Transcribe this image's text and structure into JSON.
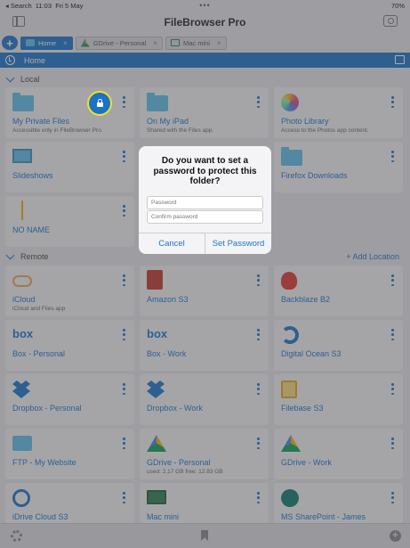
{
  "status": {
    "left": "◂ Search",
    "time": "11:03",
    "date": "Fri 5 May",
    "dots": "•••",
    "battery": "70%"
  },
  "app_title": "FileBrowser Pro",
  "tabs": [
    {
      "label": "Home",
      "active": true
    },
    {
      "label": "GDrive - Personal",
      "active": false
    },
    {
      "label": "Mac mini",
      "active": false
    }
  ],
  "tab_close": "×",
  "add_tab_glyph": "+",
  "breadcrumb": {
    "label": "Home"
  },
  "sections": {
    "local": "Local",
    "remote": "Remote",
    "add_location": "+ Add Location"
  },
  "local_items": [
    {
      "name": "My Private Files",
      "sub": "Accessible only in FileBrowser Pro.",
      "icon": "folder-icon"
    },
    {
      "name": "On My iPad",
      "sub": "Shared with the Files app.",
      "icon": "folder-icon"
    },
    {
      "name": "Photo Library",
      "sub": "Access to the Photos app content.",
      "icon": "photos-icon"
    },
    {
      "name": "Slideshows",
      "sub": "",
      "icon": "slideshow-icon"
    },
    {
      "name": "",
      "sub": "",
      "icon": "blank"
    },
    {
      "name": "Firefox Downloads",
      "sub": "",
      "icon": "folder-icon"
    },
    {
      "name": "NO NAME",
      "sub": "",
      "icon": "usb-icon"
    }
  ],
  "remote_items": [
    {
      "name": "iCloud",
      "sub": "iCloud and Files app",
      "icon": "cloud-icon"
    },
    {
      "name": "Amazon S3",
      "sub": "",
      "icon": "aws-icon"
    },
    {
      "name": "Backblaze B2",
      "sub": "",
      "icon": "backblaze-icon"
    },
    {
      "name": "Box - Personal",
      "sub": "",
      "icon": "box-icon"
    },
    {
      "name": "Box - Work",
      "sub": "",
      "icon": "box-icon"
    },
    {
      "name": "Digital Ocean S3",
      "sub": "",
      "icon": "digitalocean-icon"
    },
    {
      "name": "Dropbox - Personal",
      "sub": "",
      "icon": "dropbox-icon"
    },
    {
      "name": "Dropbox - Work",
      "sub": "",
      "icon": "dropbox-icon"
    },
    {
      "name": "Filebase S3",
      "sub": "",
      "icon": "filebase-icon"
    },
    {
      "name": "FTP - My Website",
      "sub": "",
      "icon": "ftp-icon"
    },
    {
      "name": "GDrive - Personal",
      "sub": "used: 2.17 GB free: 12.83 GB",
      "icon": "gdrive-icon"
    },
    {
      "name": "GDrive - Work",
      "sub": "",
      "icon": "gdrive-icon"
    },
    {
      "name": "iDrive Cloud S3",
      "sub": "",
      "icon": "idrive-icon"
    },
    {
      "name": "Mac mini",
      "sub": "",
      "icon": "mac-icon"
    },
    {
      "name": "MS SharePoint - James",
      "sub": "",
      "icon": "sharepoint-icon"
    }
  ],
  "dialog": {
    "question": "Do you want to set a password to protect this folder?",
    "password_placeholder": "Password",
    "confirm_placeholder": "Confirm password",
    "cancel": "Cancel",
    "set": "Set Password"
  },
  "colors": {
    "accent": "#1a73c9",
    "highlight": "#f2df22",
    "folder": "#5bbde8"
  }
}
